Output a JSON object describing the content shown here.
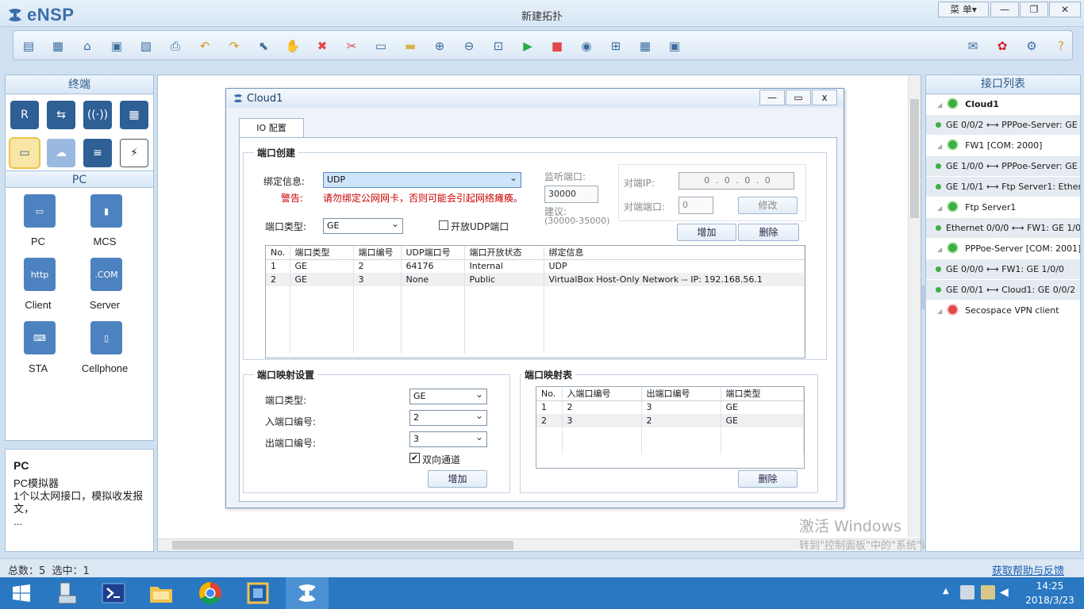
{
  "app": {
    "logo": "eNSP",
    "title": "新建拓扑",
    "menu": "菜 单▾"
  },
  "window_controls": {
    "minimize": "—",
    "restore": "❐",
    "close": "✕"
  },
  "toolbar_icons": [
    "new-topology-icon",
    "new-example-icon",
    "open-icon",
    "save-icon",
    "save-as-icon",
    "print-icon",
    "undo-icon",
    "redo-icon",
    "select-pointer-icon",
    "pan-hand-icon",
    "delete-icon",
    "delete-connections-icon",
    "text-annotation-icon",
    "rectangle-icon",
    "zoom-in-icon",
    "zoom-out-icon",
    "fit-window-icon",
    "start-device-icon",
    "stop-device-icon",
    "capture-icon",
    "topology-icon",
    "grid-icon",
    "terminal-icon"
  ],
  "toolbar_right_icons": [
    "chat-icon",
    "huawei-logo-icon",
    "settings-gear-icon",
    "help-icon"
  ],
  "left": {
    "terminal_header": "终端",
    "pc_header": "PC",
    "device_categories": [
      "router-icon",
      "switch-icon",
      "wlan-icon",
      "firewall-icon",
      "pc-icon",
      "cloud-icon",
      "other-device-icon",
      "cable-icon"
    ],
    "devices": [
      "PC",
      "MCS",
      "Client",
      "Server",
      "STA",
      "Cellphone"
    ],
    "info": {
      "title": "PC",
      "line1": "PC模拟器",
      "line2": "1个以太网接口，模拟收发报文，",
      "more": "..."
    }
  },
  "dialog": {
    "title": "Cloud1",
    "tab": "IO 配置",
    "port_create": {
      "legend": "端口创建",
      "bind_label": "绑定信息:",
      "bind_value": "UDP",
      "warning_label": "警告:",
      "warning_text": "请勿绑定公网网卡，否则可能会引起网络瘫痪。",
      "port_type_label": "端口类型:",
      "port_type_value": "GE",
      "open_udp_label": "开放UDP端口",
      "listen_port_label": "监听端口:",
      "listen_port_value": "30000",
      "suggest_label": "建议:",
      "suggest_range": "(30000-35000)",
      "remote_ip_label": "对端IP:",
      "remote_ip_value": "0 . 0 . 0 . 0",
      "remote_port_label": "对端端口:",
      "remote_port_value": "0",
      "modify_button": "修改",
      "add_button": "增加",
      "delete_button": "删除",
      "table_headers": [
        "No.",
        "端口类型",
        "端口编号",
        "UDP端口号",
        "端口开放状态",
        "绑定信息"
      ],
      "table_rows": [
        [
          "1",
          "GE",
          "2",
          "64176",
          "Internal",
          "UDP"
        ],
        [
          "2",
          "GE",
          "3",
          "None",
          "Public",
          "VirtualBox Host-Only Network -- IP: 192.168.56.1"
        ]
      ]
    },
    "mapping_settings": {
      "legend": "端口映射设置",
      "port_type_label": "端口类型:",
      "port_type_value": "GE",
      "in_port_label": "入端口编号:",
      "in_port_value": "2",
      "out_port_label": "出端口编号:",
      "out_port_value": "3",
      "bidirectional_label": "双向通道",
      "add_button": "增加"
    },
    "mapping_table": {
      "legend": "端口映射表",
      "headers": [
        "No.",
        "入端口编号",
        "出端口编号",
        "端口类型"
      ],
      "rows": [
        [
          "1",
          "2",
          "3",
          "GE"
        ],
        [
          "2",
          "3",
          "2",
          "GE"
        ]
      ],
      "delete_button": "删除"
    }
  },
  "interface_list": {
    "header": "接口列表",
    "items": [
      {
        "text": "Cloud1",
        "type": "device",
        "status": "green"
      },
      {
        "text": "GE 0/0/2 ⟷ PPPoe-Server: GE",
        "type": "link"
      },
      {
        "text": "FW1 [COM: 2000]",
        "type": "device",
        "status": "green"
      },
      {
        "text": "GE 1/0/0 ⟷ PPPoe-Server: GE",
        "type": "link"
      },
      {
        "text": "GE 1/0/1 ⟷ Ftp Server1: Ether",
        "type": "link"
      },
      {
        "text": "Ftp Server1",
        "type": "device",
        "status": "green"
      },
      {
        "text": "Ethernet 0/0/0 ⟷ FW1: GE 1/0",
        "type": "link"
      },
      {
        "text": "PPPoe-Server [COM: 2001]",
        "type": "device",
        "status": "green"
      },
      {
        "text": "GE 0/0/0 ⟷ FW1: GE 1/0/0",
        "type": "link"
      },
      {
        "text": "GE 0/0/1 ⟷ Cloud1: GE 0/0/2",
        "type": "link"
      },
      {
        "text": "Secospace VPN client",
        "type": "device",
        "status": "red"
      }
    ]
  },
  "watermark": {
    "line1": "激活 Windows",
    "line2": "转到\"控制面板\"中的\"系统\"以激活 Windows。"
  },
  "status": {
    "summary": "总数：5  选中：1",
    "help_link": "获取帮助与反馈"
  },
  "taskbar": {
    "time": "14:25",
    "date": "2018/3/23"
  },
  "colors": {
    "accent": "#3c6ea8",
    "warning": "#cc0000",
    "status_green": "#3cb043",
    "status_red": "#e04848",
    "taskbar": "#2a78c2"
  }
}
